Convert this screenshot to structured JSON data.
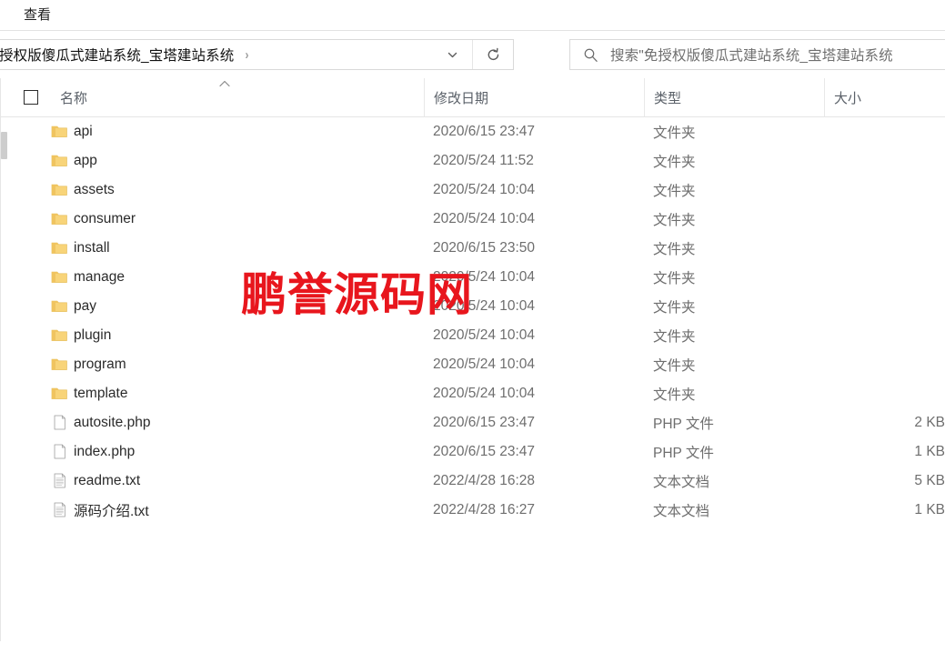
{
  "menu": {
    "tabs": [
      {
        "label": "查看",
        "name": "tab-view"
      }
    ]
  },
  "address": {
    "breadcrumb_text": "授权版傻瓜式建站系统_宝塔建站系统",
    "separator": "›",
    "dropdown_icon": "chevron-down-icon",
    "refresh_icon": "refresh-icon"
  },
  "search": {
    "icon": "search-icon",
    "text": "搜索\"免授权版傻瓜式建站系统_宝塔建站系统"
  },
  "columns": {
    "name": "名称",
    "date": "修改日期",
    "type": "类型",
    "size": "大小",
    "sort_indicator": "sort-ascending-caret",
    "select_all": "select-all-checkbox"
  },
  "watermark": {
    "text": "鹏誉源码网",
    "color": "#e8161d"
  },
  "files": [
    {
      "name": "api",
      "date": "2020/6/15 23:47",
      "type": "文件夹",
      "size": "",
      "icon": "folder-icon"
    },
    {
      "name": "app",
      "date": "2020/5/24 11:52",
      "type": "文件夹",
      "size": "",
      "icon": "folder-icon"
    },
    {
      "name": "assets",
      "date": "2020/5/24 10:04",
      "type": "文件夹",
      "size": "",
      "icon": "folder-icon"
    },
    {
      "name": "consumer",
      "date": "2020/5/24 10:04",
      "type": "文件夹",
      "size": "",
      "icon": "folder-icon"
    },
    {
      "name": "install",
      "date": "2020/6/15 23:50",
      "type": "文件夹",
      "size": "",
      "icon": "folder-icon"
    },
    {
      "name": "manage",
      "date": "2020/5/24 10:04",
      "type": "文件夹",
      "size": "",
      "icon": "folder-icon"
    },
    {
      "name": "pay",
      "date": "2020/5/24 10:04",
      "type": "文件夹",
      "size": "",
      "icon": "folder-icon"
    },
    {
      "name": "plugin",
      "date": "2020/5/24 10:04",
      "type": "文件夹",
      "size": "",
      "icon": "folder-icon"
    },
    {
      "name": "program",
      "date": "2020/5/24 10:04",
      "type": "文件夹",
      "size": "",
      "icon": "folder-icon"
    },
    {
      "name": "template",
      "date": "2020/5/24 10:04",
      "type": "文件夹",
      "size": "",
      "icon": "folder-icon"
    },
    {
      "name": "autosite.php",
      "date": "2020/6/15 23:47",
      "type": "PHP 文件",
      "size": "2 KB",
      "icon": "blank-file-icon"
    },
    {
      "name": "index.php",
      "date": "2020/6/15 23:47",
      "type": "PHP 文件",
      "size": "1 KB",
      "icon": "blank-file-icon"
    },
    {
      "name": "readme.txt",
      "date": "2022/4/28 16:28",
      "type": "文本文档",
      "size": "5 KB",
      "icon": "text-file-icon"
    },
    {
      "name": "源码介绍.txt",
      "date": "2022/4/28 16:27",
      "type": "文本文档",
      "size": "1 KB",
      "icon": "text-file-icon"
    }
  ]
}
